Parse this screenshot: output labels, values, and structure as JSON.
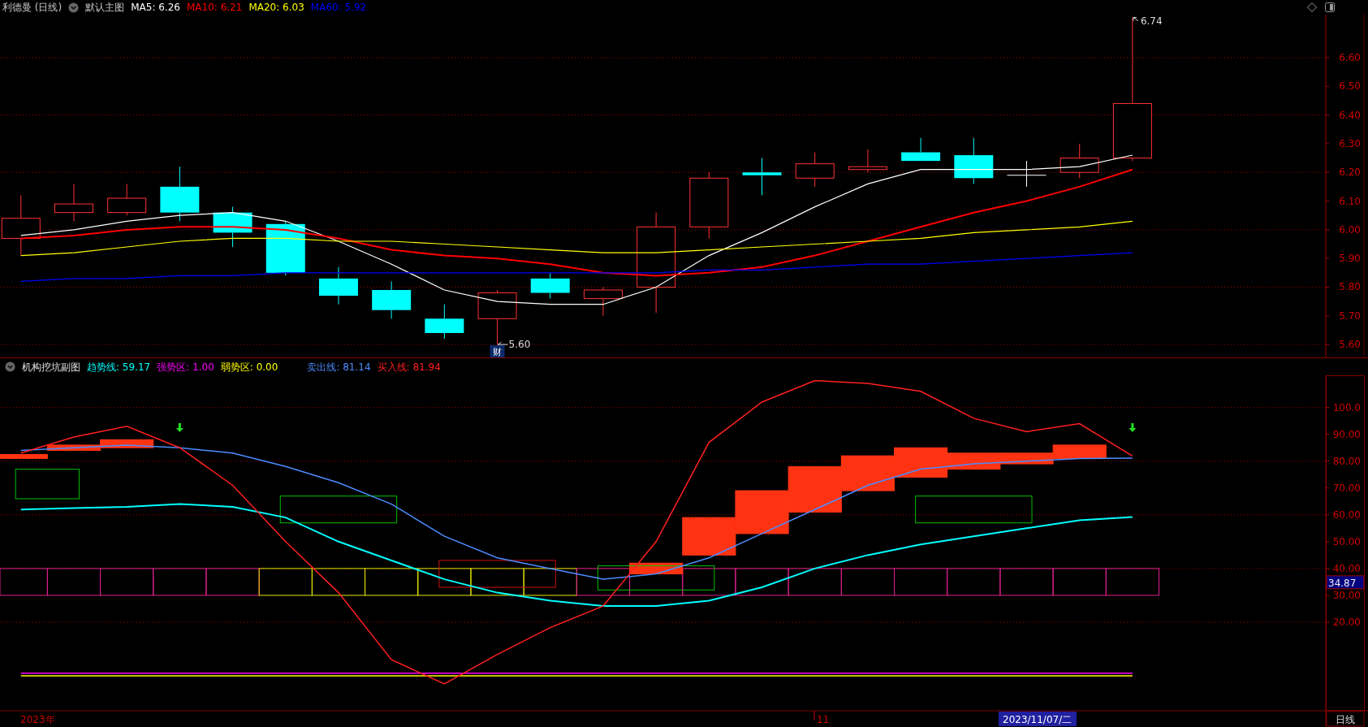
{
  "main": {
    "title": "利德曼 (日线)",
    "template": "默认主图",
    "chart_data": {
      "type": "line",
      "grid": true,
      "ylim": [
        5.555,
        6.75
      ],
      "series": [
        {
          "name": "MA5: 6.26",
          "color": "#ffffff",
          "values": [
            5.98,
            6.0,
            6.03,
            6.05,
            6.06,
            6.03,
            5.96,
            5.88,
            5.79,
            5.75,
            5.74,
            5.74,
            5.8,
            5.91,
            5.99,
            6.08,
            6.16,
            6.21,
            6.21,
            6.21,
            6.22,
            6.26
          ]
        },
        {
          "name": "MA10: 6.21",
          "color": "#ff0000",
          "values": [
            5.97,
            5.98,
            6.0,
            6.01,
            6.01,
            6.0,
            5.97,
            5.93,
            5.91,
            5.9,
            5.88,
            5.85,
            5.84,
            5.85,
            5.87,
            5.91,
            5.96,
            6.01,
            6.06,
            6.1,
            6.15,
            6.21
          ]
        },
        {
          "name": "MA20: 6.03",
          "color": "#ffff00",
          "values": [
            5.91,
            5.92,
            5.94,
            5.96,
            5.97,
            5.97,
            5.96,
            5.96,
            5.95,
            5.94,
            5.93,
            5.92,
            5.92,
            5.93,
            5.94,
            5.95,
            5.96,
            5.97,
            5.99,
            6.0,
            6.01,
            6.03
          ]
        },
        {
          "name": "MA60: 5.92",
          "color": "#0000ff",
          "values": [
            5.82,
            5.83,
            5.83,
            5.84,
            5.84,
            5.85,
            5.85,
            5.85,
            5.85,
            5.85,
            5.85,
            5.85,
            5.85,
            5.86,
            5.86,
            5.87,
            5.88,
            5.88,
            5.89,
            5.9,
            5.91,
            5.92
          ]
        }
      ],
      "yticks": [
        {
          "value": 6.6,
          "label": "6.60"
        },
        {
          "value": 6.5,
          "label": "6.50"
        },
        {
          "value": 6.4,
          "label": "6.40"
        },
        {
          "value": 6.3,
          "label": "6.30"
        },
        {
          "value": 6.2,
          "label": "6.20"
        },
        {
          "value": 6.1,
          "label": "6.10"
        },
        {
          "value": 6.0,
          "label": "6.00"
        },
        {
          "value": 5.9,
          "label": "5.90"
        },
        {
          "value": 5.8,
          "label": "5.80"
        },
        {
          "value": 5.7,
          "label": "5.70"
        },
        {
          "value": 5.6,
          "label": "5.60"
        }
      ],
      "annotations": [
        {
          "text": "6.74"
        },
        {
          "text": "5.60"
        }
      ]
    },
    "event_badge": "财"
  },
  "sub": {
    "title": "机构挖坑副图",
    "chart_data": {
      "type": "line",
      "grid": true,
      "ylim": [
        -13,
        112
      ],
      "series": [
        {
          "name": "趋势线: 59.17",
          "color": "#00ffff",
          "values": [
            62,
            62.5,
            63,
            64,
            63,
            59,
            50,
            43,
            36,
            31,
            28,
            26,
            26,
            28,
            33,
            40,
            45,
            49,
            52,
            55,
            58,
            59.17
          ]
        },
        {
          "name": "强势区: 1.00",
          "color": "#ff00ff",
          "values": [
            1,
            1,
            1,
            1,
            1,
            1,
            1,
            1,
            1,
            1,
            1,
            1,
            1,
            1,
            1,
            1,
            1,
            1,
            1,
            1,
            1,
            1
          ]
        },
        {
          "name": "弱势区: 0.00",
          "color": "#ffff00",
          "values": [
            0,
            0,
            0,
            0,
            0,
            0,
            0,
            0,
            0,
            0,
            0,
            0,
            0,
            0,
            0,
            0,
            0,
            0,
            0,
            0,
            0,
            0
          ]
        },
        {
          "name": "卖出线: 81.14",
          "color": "#4c8cff",
          "values": [
            84,
            85,
            86,
            85,
            83,
            78,
            72,
            64,
            52,
            44,
            40,
            36,
            38,
            44,
            53,
            62,
            71,
            77,
            79,
            80,
            81,
            81.14
          ]
        },
        {
          "name": "买入线: 81.94",
          "color": "#ff2020",
          "values": [
            83,
            89,
            93,
            85,
            71,
            50,
            31,
            6,
            -3,
            8,
            18,
            26,
            50,
            87,
            102,
            110,
            109,
            106,
            96,
            91,
            94,
            81.94
          ]
        }
      ],
      "yticks": [
        {
          "value": 100,
          "label": "100.0"
        },
        {
          "value": 90,
          "label": "90.00"
        },
        {
          "value": 80,
          "label": "80.00"
        },
        {
          "value": 70,
          "label": "70.00"
        },
        {
          "value": 60,
          "label": "60.00"
        },
        {
          "value": 50,
          "label": "50.00"
        },
        {
          "value": 40,
          "label": "40.00"
        },
        {
          "value": 30,
          "label": "30.00"
        },
        {
          "value": 20,
          "label": "20.00"
        }
      ]
    },
    "time_labels": [
      "2023年",
      "11"
    ],
    "cursor_value": "34.87",
    "cursor_date": "2023/11/07/二",
    "period": "日线"
  }
}
